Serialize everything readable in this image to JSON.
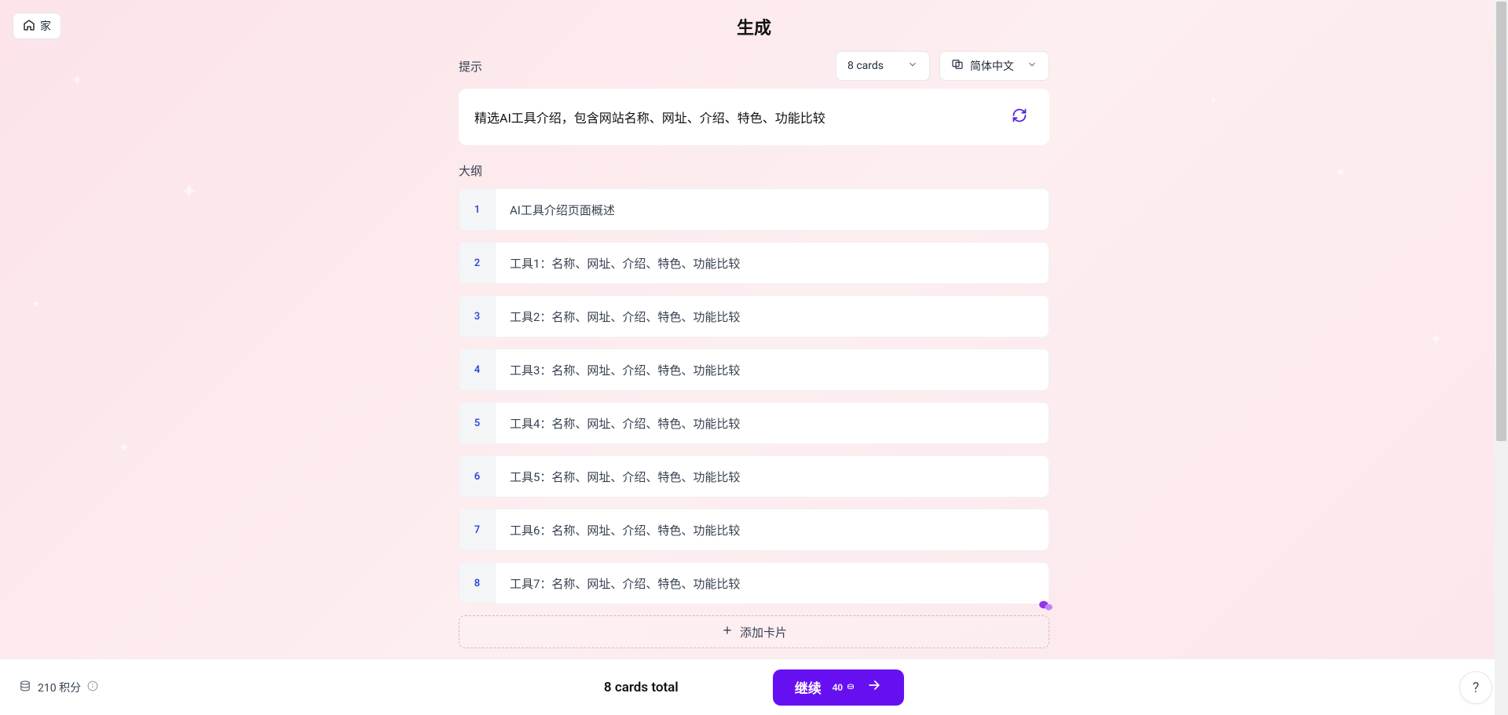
{
  "nav": {
    "home": "家"
  },
  "header": {
    "title": "生成"
  },
  "prompt": {
    "label": "提示",
    "text": "精选AI工具介绍，包含网站名称、网址、介绍、特色、功能比较"
  },
  "selectors": {
    "cards": "8 cards",
    "language": "简体中文"
  },
  "outline": {
    "label": "大纲",
    "items": [
      {
        "n": "1",
        "text": "AI工具介绍页面概述"
      },
      {
        "n": "2",
        "text": "工具1：名称、网址、介绍、特色、功能比较"
      },
      {
        "n": "3",
        "text": "工具2：名称、网址、介绍、特色、功能比较"
      },
      {
        "n": "4",
        "text": "工具3：名称、网址、介绍、特色、功能比较"
      },
      {
        "n": "5",
        "text": "工具4：名称、网址、介绍、特色、功能比较"
      },
      {
        "n": "6",
        "text": "工具5：名称、网址、介绍、特色、功能比较"
      },
      {
        "n": "7",
        "text": "工具6：名称、网址、介绍、特色、功能比较"
      },
      {
        "n": "8",
        "text": "工具7：名称、网址、介绍、特色、功能比较"
      }
    ],
    "add_label": "添加卡片"
  },
  "footer": {
    "credits": "210 积分",
    "total": "8 cards total",
    "continue": "继续",
    "cost": "40"
  },
  "help": "?"
}
